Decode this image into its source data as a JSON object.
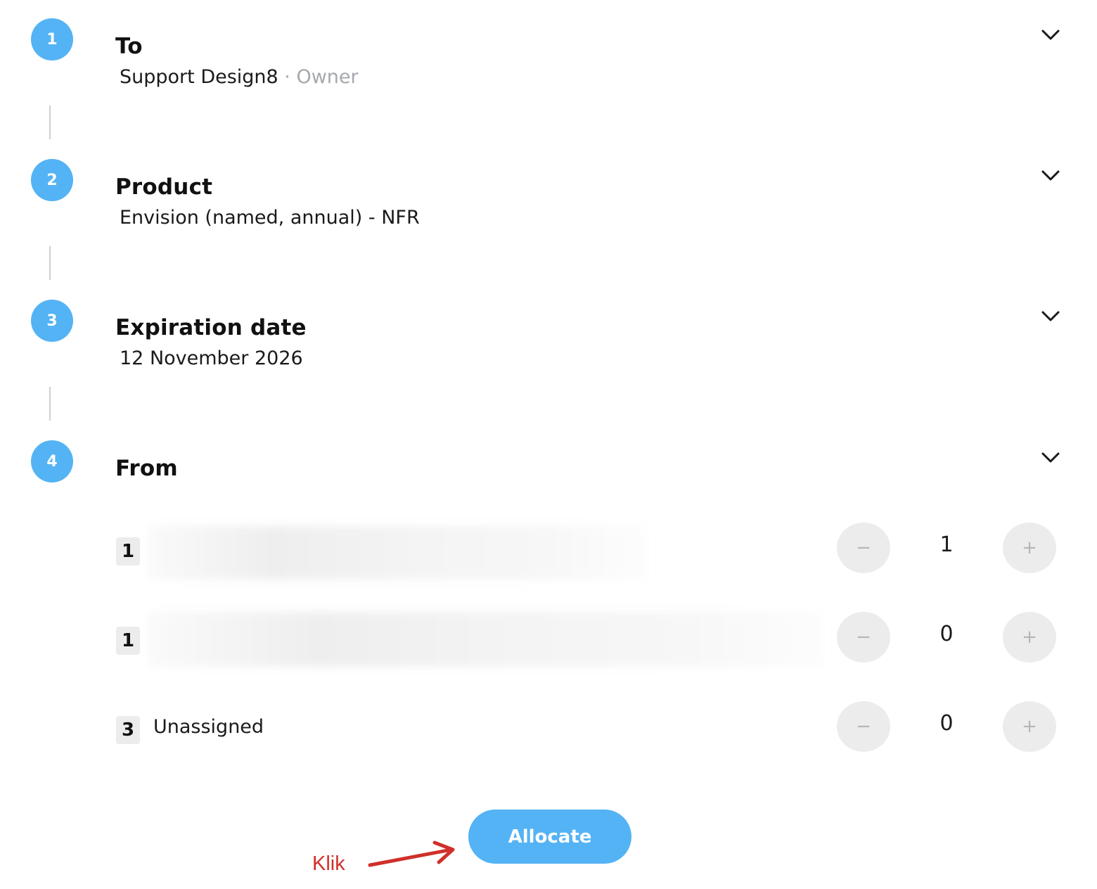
{
  "steps": [
    {
      "number": "1",
      "title": "To",
      "value": "Support Design8",
      "value_suffix": " · Owner"
    },
    {
      "number": "2",
      "title": "Product",
      "value": "Envision (named, annual) - NFR"
    },
    {
      "number": "3",
      "title": "Expiration date",
      "value": "12 November 2026"
    },
    {
      "number": "4",
      "title": "From"
    }
  ],
  "from_rows": [
    {
      "badge": "1",
      "label": "",
      "quantity": "1"
    },
    {
      "badge": "1",
      "label": "",
      "quantity": "0"
    },
    {
      "badge": "3",
      "label": "Unassigned",
      "quantity": "0"
    }
  ],
  "stepper": {
    "minus": "−",
    "plus": "+"
  },
  "allocate_label": "Allocate",
  "annotation": {
    "text": "Klik"
  },
  "colors": {
    "accent": "#54b3f5",
    "annotation": "#d0302a",
    "muted": "#a5a8ae"
  },
  "icons": {
    "expand": "chevron-down-icon"
  }
}
